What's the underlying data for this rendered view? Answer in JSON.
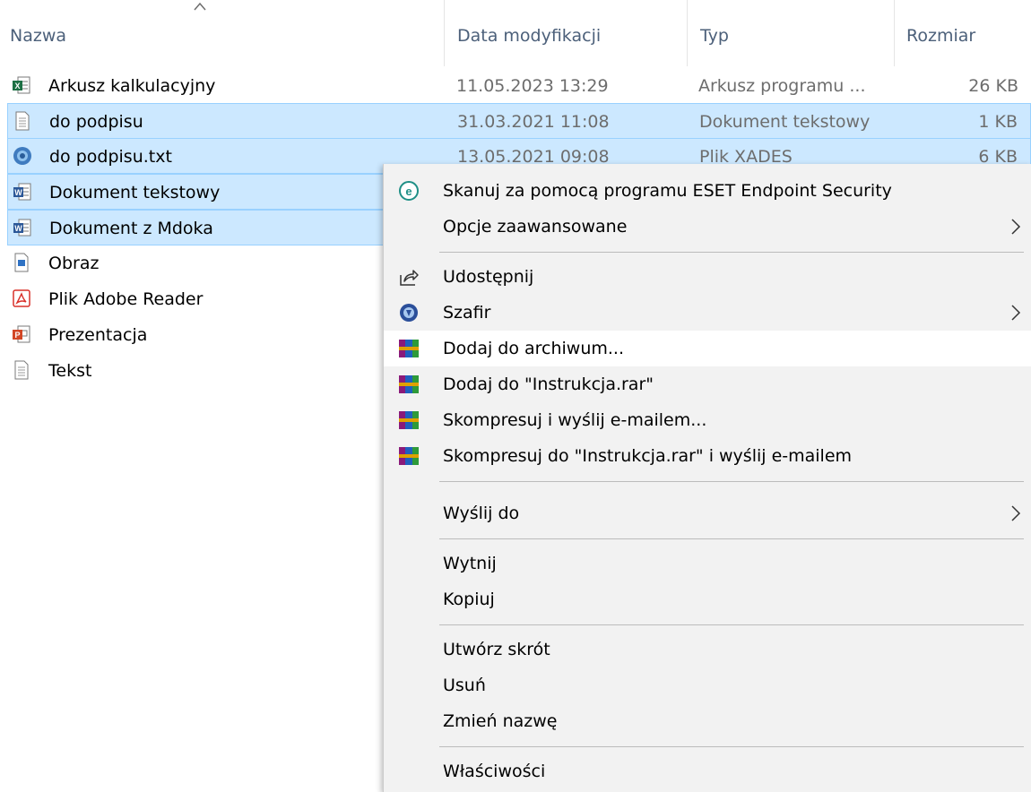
{
  "columns": {
    "name": "Nazwa",
    "date": "Data modyfikacji",
    "type": "Typ",
    "size": "Rozmiar"
  },
  "files": [
    {
      "name": "Arkusz kalkulacyjny",
      "date": "11.05.2023 13:29",
      "type": "Arkusz programu ...",
      "size": "26 KB",
      "icon": "excel-file-icon",
      "selected": false
    },
    {
      "name": "do podpisu",
      "date": "31.03.2021 11:08",
      "type": "Dokument tekstowy",
      "size": "1 KB",
      "icon": "text-file-icon",
      "selected": true
    },
    {
      "name": "do podpisu.txt",
      "date": "13.05.2021 09:08",
      "type": "Plik XADES",
      "size": "6 KB",
      "icon": "xades-file-icon",
      "selected": true
    },
    {
      "name": "Dokument tekstowy",
      "date": "",
      "type": "",
      "size": "",
      "icon": "word-file-icon",
      "selected": true
    },
    {
      "name": "Dokument z Mdoka",
      "date": "",
      "type": "",
      "size": "",
      "icon": "word-file-icon",
      "selected": true
    },
    {
      "name": "Obraz",
      "date": "",
      "type": "",
      "size": "",
      "icon": "image-file-icon",
      "selected": false
    },
    {
      "name": "Plik Adobe Reader",
      "date": "",
      "type": "",
      "size": "",
      "icon": "pdf-file-icon",
      "selected": false
    },
    {
      "name": "Prezentacja",
      "date": "",
      "type": "",
      "size": "",
      "icon": "powerpoint-file-icon",
      "selected": false
    },
    {
      "name": "Tekst",
      "date": "",
      "type": "",
      "size": "",
      "icon": "text-file-icon",
      "selected": false
    }
  ],
  "context_menu": {
    "items": [
      {
        "label": "Skanuj za pomocą programu ESET Endpoint Security",
        "icon": "eset-icon",
        "submenu": false
      },
      {
        "label": "Opcje zaawansowane",
        "icon": "",
        "submenu": true
      },
      {
        "label": "Udostępnij",
        "icon": "share-icon",
        "submenu": false
      },
      {
        "label": "Szafir",
        "icon": "szafir-icon",
        "submenu": true
      },
      {
        "label": "Dodaj do archiwum...",
        "icon": "winrar-icon",
        "submenu": false,
        "hover": true
      },
      {
        "label": "Dodaj do \"Instrukcja.rar\"",
        "icon": "winrar-icon",
        "submenu": false
      },
      {
        "label": "Skompresuj i wyślij e-mailem...",
        "icon": "winrar-icon",
        "submenu": false
      },
      {
        "label": "Skompresuj do \"Instrukcja.rar\" i wyślij e-mailem",
        "icon": "winrar-icon",
        "submenu": false
      },
      {
        "label": "Wyślij do",
        "icon": "",
        "submenu": true
      },
      {
        "label": "Wytnij",
        "icon": "",
        "submenu": false
      },
      {
        "label": "Kopiuj",
        "icon": "",
        "submenu": false
      },
      {
        "label": "Utwórz skrót",
        "icon": "",
        "submenu": false
      },
      {
        "label": "Usuń",
        "icon": "",
        "submenu": false
      },
      {
        "label": "Zmień nazwę",
        "icon": "",
        "submenu": false
      },
      {
        "label": "Właściwości",
        "icon": "",
        "submenu": false
      }
    ]
  },
  "colors": {
    "selection": "#cce8ff",
    "selection_border": "#99d1ff",
    "header_text": "#4c607a",
    "menu_bg": "#f2f2f2"
  }
}
